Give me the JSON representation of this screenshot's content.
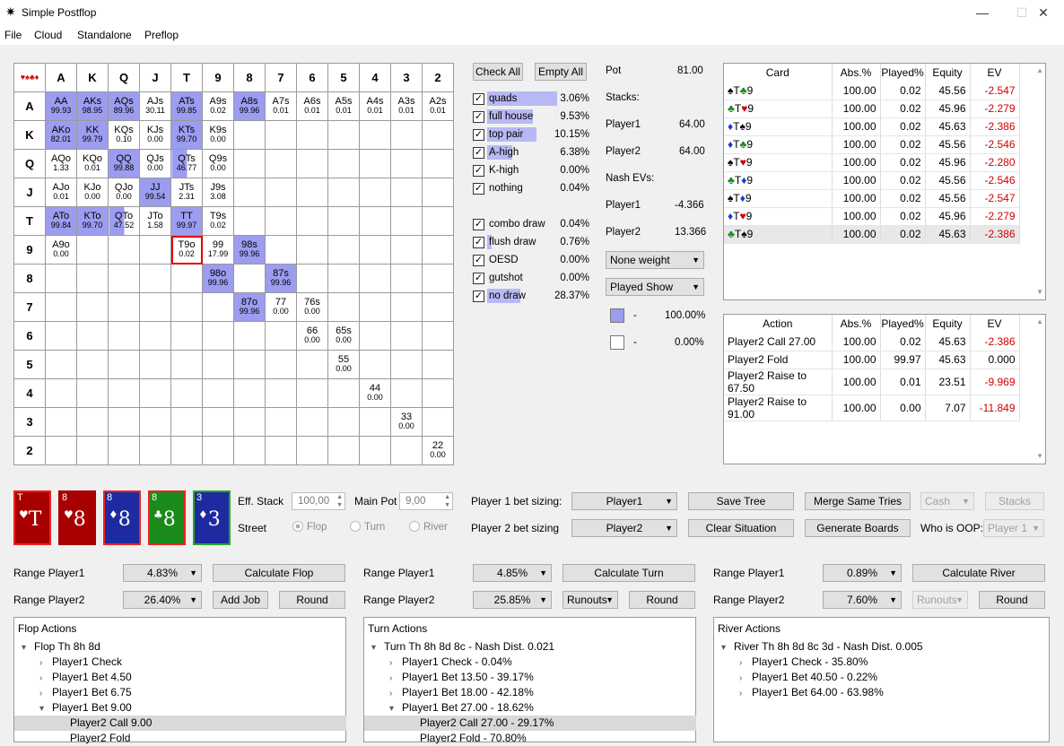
{
  "window": {
    "title": "Simple Postflop",
    "icon": "poker-chip-icon"
  },
  "menu": [
    "File",
    "Cloud",
    "Standalone",
    "Preflop"
  ],
  "grid": {
    "corner": "♥♠♣♦",
    "ranks": [
      "A",
      "K",
      "Q",
      "J",
      "T",
      "9",
      "8",
      "7",
      "6",
      "5",
      "4",
      "3",
      "2"
    ],
    "rows": [
      [
        [
          "AA",
          "99.93",
          "f"
        ],
        [
          "AKs",
          "98.95",
          "f"
        ],
        [
          "AQs",
          "89.96",
          "f"
        ],
        [
          "AJs",
          "30.11",
          "n"
        ],
        [
          "ATs",
          "99.85",
          "f"
        ],
        [
          "A9s",
          "0.02",
          "n"
        ],
        [
          "A8s",
          "99.96",
          "f"
        ],
        [
          "A7s",
          "0.01",
          "n"
        ],
        [
          "A6s",
          "0.01",
          "n"
        ],
        [
          "A5s",
          "0.01",
          "n"
        ],
        [
          "A4s",
          "0.01",
          "n"
        ],
        [
          "A3s",
          "0.01",
          "n"
        ],
        [
          "A2s",
          "0.01",
          "n"
        ]
      ],
      [
        [
          "AKo",
          "82.01",
          "f"
        ],
        [
          "KK",
          "99.79",
          "f"
        ],
        [
          "KQs",
          "0.10",
          "n"
        ],
        [
          "KJs",
          "0.00",
          "n"
        ],
        [
          "KTs",
          "99.70",
          "f"
        ],
        [
          "K9s",
          "0.00",
          "n"
        ],
        null,
        null,
        null,
        null,
        null,
        null,
        null
      ],
      [
        [
          "AQo",
          "1.33",
          "n"
        ],
        [
          "KQo",
          "0.01",
          "n"
        ],
        [
          "QQ",
          "99.88",
          "f"
        ],
        [
          "QJs",
          "0.00",
          "n"
        ],
        [
          "QTs",
          "46.77",
          "p"
        ],
        [
          "Q9s",
          "0.00",
          "n"
        ],
        null,
        null,
        null,
        null,
        null,
        null,
        null
      ],
      [
        [
          "AJo",
          "0.01",
          "n"
        ],
        [
          "KJo",
          "0.00",
          "n"
        ],
        [
          "QJo",
          "0.00",
          "n"
        ],
        [
          "JJ",
          "99.54",
          "f"
        ],
        [
          "JTs",
          "2.31",
          "n"
        ],
        [
          "J9s",
          "3.08",
          "n"
        ],
        null,
        null,
        null,
        null,
        null,
        null,
        null
      ],
      [
        [
          "ATo",
          "99.84",
          "f"
        ],
        [
          "KTo",
          "99.70",
          "f"
        ],
        [
          "QTo",
          "47.52",
          "p"
        ],
        [
          "JTo",
          "1.58",
          "n"
        ],
        [
          "TT",
          "99.97",
          "f"
        ],
        [
          "T9s",
          "0.02",
          "n"
        ],
        null,
        null,
        null,
        null,
        null,
        null,
        null
      ],
      [
        [
          "A9o",
          "0.00",
          "n"
        ],
        null,
        null,
        null,
        [
          "T9o",
          "0.02",
          "s"
        ],
        [
          "99",
          "17.99",
          "n"
        ],
        [
          "98s",
          "99.96",
          "f"
        ],
        null,
        null,
        null,
        null,
        null,
        null
      ],
      [
        null,
        null,
        null,
        null,
        null,
        [
          "98o",
          "99.96",
          "f"
        ],
        null,
        [
          "87s",
          "99.96",
          "f"
        ],
        null,
        null,
        null,
        null,
        null
      ],
      [
        null,
        null,
        null,
        null,
        null,
        null,
        [
          "87o",
          "99.96",
          "f"
        ],
        [
          "77",
          "0.00",
          "n"
        ],
        [
          "76s",
          "0.00",
          "n"
        ],
        null,
        null,
        null,
        null
      ],
      [
        null,
        null,
        null,
        null,
        null,
        null,
        null,
        null,
        [
          "66",
          "0.00",
          "n"
        ],
        [
          "65s",
          "0.00",
          "n"
        ],
        null,
        null,
        null
      ],
      [
        null,
        null,
        null,
        null,
        null,
        null,
        null,
        null,
        null,
        [
          "55",
          "0.00",
          "n"
        ],
        null,
        null,
        null
      ],
      [
        null,
        null,
        null,
        null,
        null,
        null,
        null,
        null,
        null,
        null,
        [
          "44",
          "0.00",
          "n"
        ],
        null,
        null
      ],
      [
        null,
        null,
        null,
        null,
        null,
        null,
        null,
        null,
        null,
        null,
        null,
        [
          "33",
          "0.00",
          "n"
        ],
        null
      ],
      [
        null,
        null,
        null,
        null,
        null,
        null,
        null,
        null,
        null,
        null,
        null,
        null,
        [
          "22",
          "0.00",
          "n"
        ]
      ]
    ]
  },
  "filters": {
    "check_all": "Check All",
    "empty_all": "Empty All",
    "hands": [
      {
        "label": "quads",
        "pct": "3.06%",
        "bar": 0.85
      },
      {
        "label": "full house",
        "pct": "9.53%",
        "bar": 0.55
      },
      {
        "label": "top pair",
        "pct": "10.15%",
        "bar": 0.6
      },
      {
        "label": "A-high",
        "pct": "6.38%",
        "bar": 0.3
      },
      {
        "label": "K-high",
        "pct": "0.00%",
        "bar": 0
      },
      {
        "label": "nothing",
        "pct": "0.04%",
        "bar": 0
      }
    ],
    "draws": [
      {
        "label": "combo draw",
        "pct": "0.04%",
        "bar": 0
      },
      {
        "label": "flush draw",
        "pct": "0.76%",
        "bar": 0.05
      },
      {
        "label": "OESD",
        "pct": "0.00%",
        "bar": 0
      },
      {
        "label": "gutshot",
        "pct": "0.00%",
        "bar": 0
      },
      {
        "label": "no draw",
        "pct": "28.37%",
        "bar": 0.4
      }
    ]
  },
  "info": {
    "pot_label": "Pot",
    "pot": "81.00",
    "stacks": "Stacks:",
    "p1": "Player1",
    "p1_stack": "64.00",
    "p2": "Player2",
    "p2_stack": "64.00",
    "nash": "Nash EVs:",
    "p1_ev": "-4.366",
    "p2_ev": "13.366",
    "weight": "None weight",
    "show": "Played Show",
    "legend1": "100.00%",
    "legend2": "0.00%",
    "dash": "-"
  },
  "card_table": {
    "headers": [
      "Card",
      "Abs.%",
      "Played%",
      "Equity",
      "EV"
    ],
    "rows": [
      [
        [
          "♠",
          "T",
          "#000"
        ],
        [
          "♣",
          "9",
          "#1a8a1a"
        ],
        "100.00",
        "0.02",
        "45.56",
        "-2.547"
      ],
      [
        [
          "♣",
          "T",
          "#1a8a1a"
        ],
        [
          "♥",
          "9",
          "#d00000"
        ],
        "100.00",
        "0.02",
        "45.96",
        "-2.279"
      ],
      [
        [
          "♦",
          "T",
          "#1a3ad0"
        ],
        [
          "♠",
          "9",
          "#000"
        ],
        "100.00",
        "0.02",
        "45.63",
        "-2.386"
      ],
      [
        [
          "♦",
          "T",
          "#1a3ad0"
        ],
        [
          "♣",
          "9",
          "#1a8a1a"
        ],
        "100.00",
        "0.02",
        "45.56",
        "-2.546"
      ],
      [
        [
          "♠",
          "T",
          "#000"
        ],
        [
          "♥",
          "9",
          "#d00000"
        ],
        "100.00",
        "0.02",
        "45.96",
        "-2.280"
      ],
      [
        [
          "♣",
          "T",
          "#1a8a1a"
        ],
        [
          "♦",
          "9",
          "#1a3ad0"
        ],
        "100.00",
        "0.02",
        "45.56",
        "-2.546"
      ],
      [
        [
          "♠",
          "T",
          "#000"
        ],
        [
          "♦",
          "9",
          "#1a3ad0"
        ],
        "100.00",
        "0.02",
        "45.56",
        "-2.547"
      ],
      [
        [
          "♦",
          "T",
          "#1a3ad0"
        ],
        [
          "♥",
          "9",
          "#d00000"
        ],
        "100.00",
        "0.02",
        "45.96",
        "-2.279"
      ],
      [
        [
          "♣",
          "T",
          "#1a8a1a"
        ],
        [
          "♠",
          "9",
          "#000"
        ],
        "100.00",
        "0.02",
        "45.63",
        "-2.386"
      ]
    ]
  },
  "action_table": {
    "headers": [
      "Action",
      "Abs.%",
      "Played%",
      "Equity",
      "EV"
    ],
    "rows": [
      [
        "Player2 Call 27.00",
        "100.00",
        "0.02",
        "45.63",
        "-2.386",
        true
      ],
      [
        "Player2 Fold",
        "100.00",
        "99.97",
        "45.63",
        "0.000",
        false
      ],
      [
        "Player2 Raise to 67.50",
        "100.00",
        "0.01",
        "23.51",
        "-9.969",
        true
      ],
      [
        "Player2 Raise to 91.00",
        "100.00",
        "0.00",
        "7.07",
        "-11.849",
        true
      ]
    ]
  },
  "board": [
    {
      "tl": "T",
      "suit": "♥",
      "rank": "T",
      "bg": "#a80000",
      "bd": "#e22"
    },
    {
      "tl": "8",
      "suit": "♥",
      "rank": "8",
      "bg": "#a80000",
      "bd": "#a80000"
    },
    {
      "tl": "8",
      "suit": "♦",
      "rank": "8",
      "bg": "#1e2aa0",
      "bd": "#e22"
    },
    {
      "tl": "8",
      "suit": "♣",
      "rank": "8",
      "bg": "#1a8a1a",
      "bd": "#e22"
    },
    {
      "tl": "3",
      "suit": "♦",
      "rank": "3",
      "bg": "#1e2aa0",
      "bd": "#2a2"
    }
  ],
  "controls": {
    "eff_stack": "Eff. Stack",
    "eff_val": "100,00",
    "main_pot": "Main Pot",
    "pot_val": "9,00",
    "street": "Street",
    "flop": "Flop",
    "turn": "Turn",
    "river": "River",
    "p1_bet": "Player 1 bet sizing:",
    "p2_bet": "Player 2 bet sizing",
    "p1_sel": "Player1",
    "p2_sel": "Player2",
    "save_tree": "Save Tree",
    "clear": "Clear Situation",
    "merge": "Merge Same Tries",
    "gen": "Generate Boards",
    "cash": "Cash",
    "stacks": "Stacks",
    "oop": "Who is OOP:",
    "oop_sel": "Player 1"
  },
  "ranges": [
    {
      "r1": "Range Player1",
      "r1v": "4.83%",
      "r2": "Range Player2",
      "r2v": "26.40%",
      "calc": "Calculate Flop",
      "b2": "Add Job",
      "b3": "Round"
    },
    {
      "r1": "Range Player1",
      "r1v": "4.85%",
      "r2": "Range Player2",
      "r2v": "25.85%",
      "calc": "Calculate Turn",
      "b2": "Runouts",
      "b3": "Round"
    },
    {
      "r1": "Range Player1",
      "r1v": "0.89%",
      "r2": "Range Player2",
      "r2v": "7.60%",
      "calc": "Calculate River",
      "b2": "Runouts",
      "b3": "Round"
    }
  ],
  "flop_actions": {
    "header": "Flop Actions",
    "items": [
      [
        "▾",
        "Flop Th 8h 8d",
        0,
        false
      ],
      [
        "›",
        "Player1 Check",
        1,
        false
      ],
      [
        "›",
        "Player1 Bet 4.50",
        1,
        false
      ],
      [
        "›",
        "Player1 Bet 6.75",
        1,
        false
      ],
      [
        "▾",
        "Player1 Bet 9.00",
        1,
        false
      ],
      [
        "",
        "Player2 Call 9.00",
        2,
        true
      ],
      [
        "",
        "Player2 Fold",
        2,
        false
      ]
    ]
  },
  "turn_actions": {
    "header": "Turn Actions",
    "items": [
      [
        "▾",
        "Turn Th 8h 8d 8c - Nash Dist. 0.021",
        0,
        false
      ],
      [
        "›",
        "Player1 Check - 0.04%",
        1,
        false
      ],
      [
        "›",
        "Player1 Bet 13.50 - 39.17%",
        1,
        false
      ],
      [
        "›",
        "Player1 Bet 18.00 - 42.18%",
        1,
        false
      ],
      [
        "▾",
        "Player1 Bet 27.00 - 18.62%",
        1,
        false
      ],
      [
        "",
        "Player2 Call 27.00 - 29.17%",
        2,
        true
      ],
      [
        "",
        "Player2 Fold - 70.80%",
        2,
        false
      ]
    ]
  },
  "river_actions": {
    "header": "River Actions",
    "items": [
      [
        "▾",
        "River Th 8h 8d 8c 3d - Nash Dist. 0.005",
        0,
        false
      ],
      [
        "›",
        "Player1 Check - 35.80%",
        1,
        false
      ],
      [
        "›",
        "Player1 Bet 40.50 - 0.22%",
        1,
        false
      ],
      [
        "›",
        "Player1 Bet 64.00 - 63.98%",
        1,
        false
      ]
    ]
  }
}
